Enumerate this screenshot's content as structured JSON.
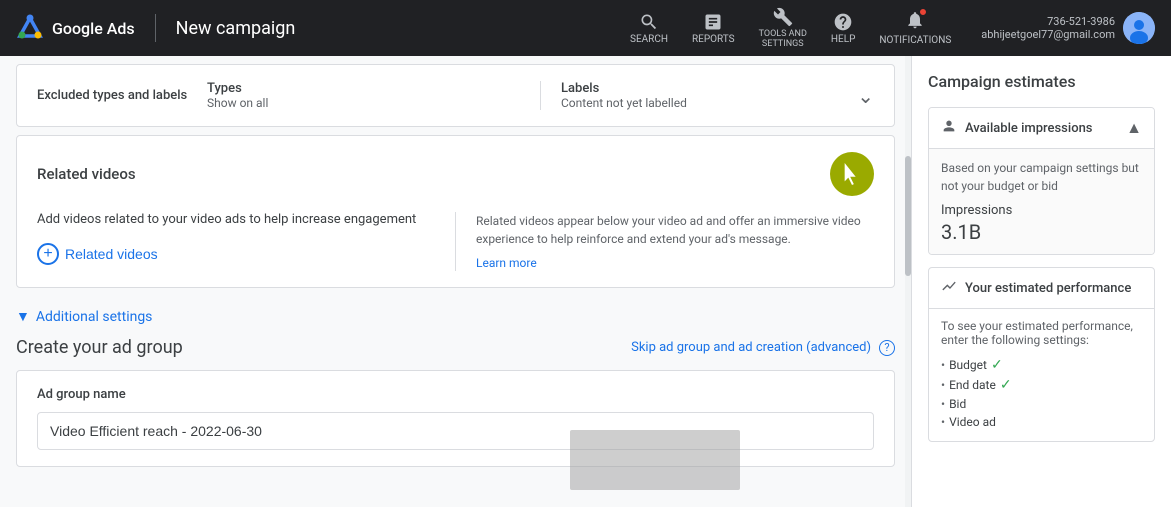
{
  "nav": {
    "logo_text": "Google Ads",
    "page_title": "New campaign",
    "icons": [
      {
        "name": "search-icon",
        "label": "SEARCH"
      },
      {
        "name": "reports-icon",
        "label": "REPORTS"
      },
      {
        "name": "tools-icon",
        "label": "TOOLS AND SETTINGS"
      },
      {
        "name": "help-icon",
        "label": "HELP"
      },
      {
        "name": "notifications-icon",
        "label": "NOTIFICATIONS"
      }
    ],
    "user_email": "abhijeetgoel77@gmail.com",
    "user_phone": "736-521-3986"
  },
  "excluded_types": {
    "section_label": "Excluded types and labels",
    "types_label": "Types",
    "types_value": "Show on all",
    "labels_label": "Labels",
    "labels_value": "Content not yet labelled"
  },
  "related_videos": {
    "title": "Related videos",
    "description": "Add videos related to your video ads to help increase engagement",
    "button_label": "Related videos",
    "right_desc": "Related videos appear below your video ad and offer an immersive video experience to help reinforce and extend your ad's message.",
    "learn_more": "Learn more"
  },
  "additional_settings": {
    "label": "Additional settings"
  },
  "create_ad_group": {
    "title": "Create your ad group",
    "skip_label": "Skip ad group and ad creation (advanced)",
    "ad_group_name_label": "Ad group name",
    "ad_group_name_value": "Video Efficient reach - 2022-06-30"
  },
  "campaign_estimates": {
    "title": "Campaign estimates",
    "available_impressions": {
      "title": "Available impressions",
      "body": "Based on your campaign settings but not your budget or bid",
      "impressions_label": "Impressions",
      "impressions_value": "3.1B"
    },
    "estimated_performance": {
      "title": "Your estimated performance",
      "body": "To see your estimated performance, enter the following settings:",
      "items": [
        {
          "label": "Budget",
          "checked": true
        },
        {
          "label": "End date",
          "checked": true
        },
        {
          "label": "Bid",
          "checked": false
        },
        {
          "label": "Video ad",
          "checked": false
        }
      ]
    }
  }
}
